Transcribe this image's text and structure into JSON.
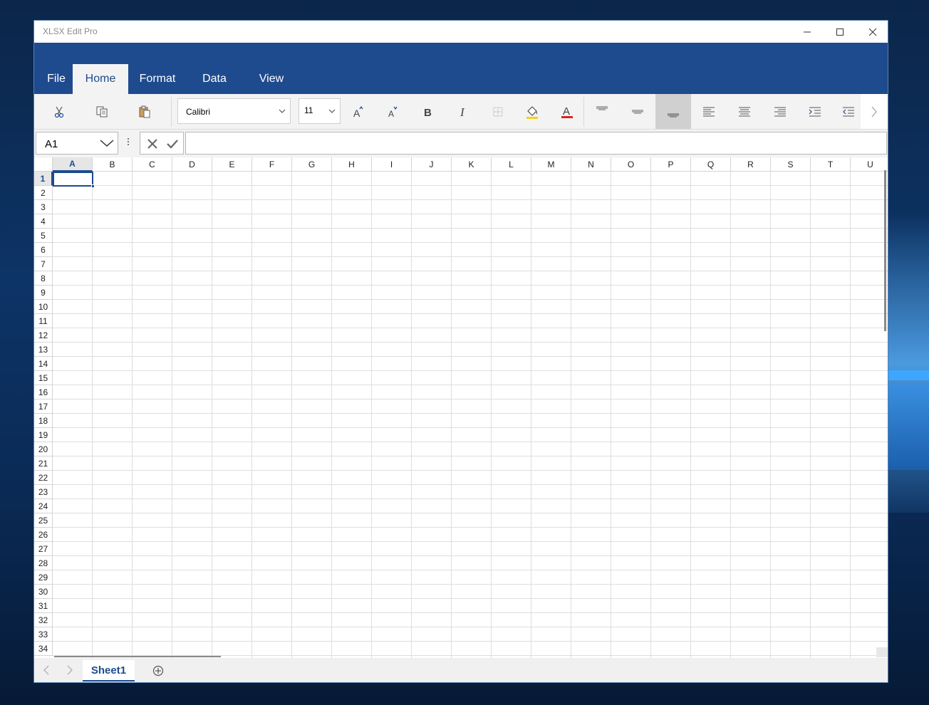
{
  "window": {
    "title": "XLSX Edit Pro",
    "controls": {
      "minimize": "minimize-icon",
      "maximize": "maximize-icon",
      "close": "close-icon"
    }
  },
  "ribbon": {
    "tabs": [
      {
        "label": "File",
        "active": false
      },
      {
        "label": "Home",
        "active": true
      },
      {
        "label": "Format",
        "active": false
      },
      {
        "label": "Data",
        "active": false
      },
      {
        "label": "View",
        "active": false
      }
    ],
    "accent": "#1e4b8e"
  },
  "toolbar": {
    "font_name": "Calibri",
    "font_size": "11",
    "icons": [
      "cut-icon",
      "copy-icon",
      "paste-icon",
      "increase-font-icon",
      "decrease-font-icon",
      "bold-icon",
      "italic-icon",
      "borders-icon",
      "fill-color-icon",
      "font-color-icon",
      "align-top-icon",
      "align-middle-icon",
      "align-bottom-icon",
      "align-left-icon",
      "align-center-icon",
      "align-right-icon",
      "increase-indent-icon",
      "decrease-indent-icon",
      "more-chevron-icon"
    ],
    "selected_vertical_alignment": "bottom"
  },
  "formula_bar": {
    "cell_ref": "A1",
    "formula": ""
  },
  "grid": {
    "columns": [
      "A",
      "B",
      "C",
      "D",
      "E",
      "F",
      "G",
      "H",
      "I",
      "J",
      "K",
      "L",
      "M",
      "N",
      "O",
      "P",
      "Q",
      "R",
      "S",
      "T",
      "U"
    ],
    "rows": [
      "1",
      "2",
      "3",
      "4",
      "5",
      "6",
      "7",
      "8",
      "9",
      "10",
      "11",
      "12",
      "13",
      "14",
      "15",
      "16",
      "17",
      "18",
      "19",
      "20",
      "21",
      "22",
      "23",
      "24",
      "25",
      "26",
      "27",
      "28",
      "29",
      "30",
      "31",
      "32",
      "33",
      "34"
    ],
    "active_cell": "A1"
  },
  "sheets": {
    "tabs": [
      "Sheet1"
    ],
    "active": "Sheet1"
  }
}
